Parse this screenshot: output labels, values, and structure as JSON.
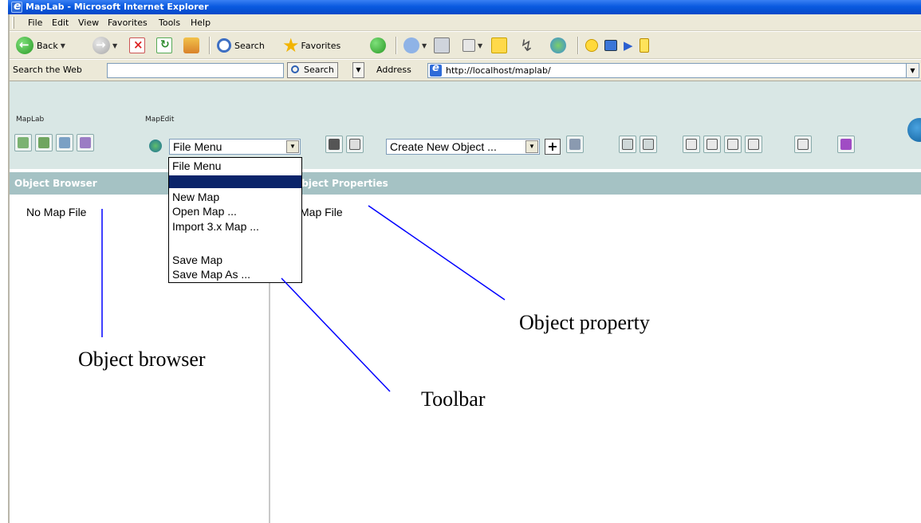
{
  "window": {
    "title": "MapLab - Microsoft Internet Explorer"
  },
  "menubar": {
    "items": [
      "File",
      "Edit",
      "View",
      "Favorites",
      "Tools",
      "Help"
    ]
  },
  "toolbar": {
    "back_label": "Back",
    "search_label": "Search",
    "favorites_label": "Favorites"
  },
  "addressbar": {
    "search_web_label": "Search the Web",
    "search_button": "Search",
    "address_label": "Address",
    "url": "http://localhost/maplab/"
  },
  "app": {
    "maplab_label": "MapLab",
    "mapedit_label": "MapEdit",
    "file_menu_select": "File Menu",
    "create_object_select": "Create New Object ...",
    "add_button": "+",
    "file_menu_options": [
      "File Menu",
      "",
      "New Map",
      "Open Map ...",
      "Import 3.x Map ...",
      "",
      "Save Map",
      "Save Map As ..."
    ],
    "object_browser_header": "Object Browser",
    "object_properties_header": "Object Properties",
    "object_browser_text": "No Map File",
    "object_properties_text": "Map File"
  },
  "annotations": {
    "object_browser": "Object browser",
    "toolbar": "Toolbar",
    "object_property": "Object property"
  },
  "colors": {
    "titlebar": "#0a5ae0",
    "chrome": "#ece9d8",
    "app_toolbar": "#d9e7e5",
    "panel_header": "#a5c2c4",
    "highlight": "#0a246a",
    "callout_line": "#0000ff"
  }
}
